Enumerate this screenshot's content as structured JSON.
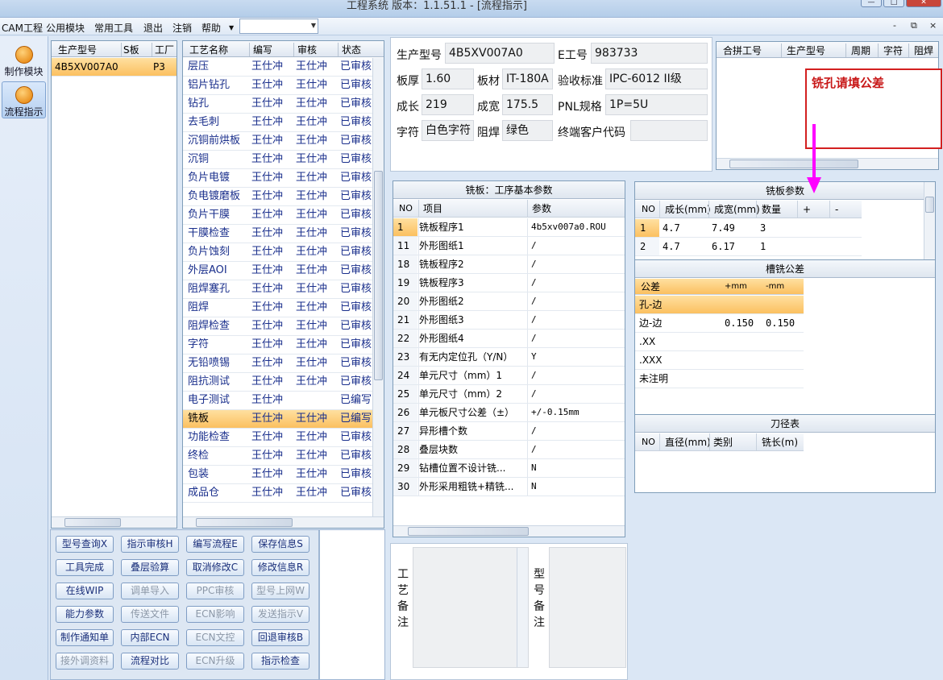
{
  "window": {
    "title": "工程系统  版本：1.1.51.1 - [流程指示]"
  },
  "menu": {
    "items": [
      "CAM工程",
      "公用模块",
      "常用工具",
      "退出",
      "注销",
      "帮助"
    ],
    "mdi": [
      "-",
      "⧉",
      "×"
    ]
  },
  "sidebar": {
    "items": [
      {
        "label": "制作模块"
      },
      {
        "label": "流程指示"
      }
    ]
  },
  "models": {
    "headers": [
      "生产型号",
      "S板",
      "工厂"
    ],
    "rows": [
      {
        "model": "4B5XV007A0",
        "s": "",
        "factory": "P3"
      }
    ]
  },
  "process": {
    "headers": [
      "工艺名称",
      "编写",
      "审核",
      "状态"
    ],
    "rows": [
      {
        "name": "层压",
        "writer": "王仕冲",
        "reviewer": "王仕冲",
        "status": "已审核"
      },
      {
        "name": "铝片钻孔",
        "writer": "王仕冲",
        "reviewer": "王仕冲",
        "status": "已审核"
      },
      {
        "name": "钻孔",
        "writer": "王仕冲",
        "reviewer": "王仕冲",
        "status": "已审核"
      },
      {
        "name": "去毛刺",
        "writer": "王仕冲",
        "reviewer": "王仕冲",
        "status": "已审核"
      },
      {
        "name": "沉铜前烘板",
        "writer": "王仕冲",
        "reviewer": "王仕冲",
        "status": "已审核"
      },
      {
        "name": "沉铜",
        "writer": "王仕冲",
        "reviewer": "王仕冲",
        "status": "已审核"
      },
      {
        "name": "负片电镀",
        "writer": "王仕冲",
        "reviewer": "王仕冲",
        "status": "已审核"
      },
      {
        "name": "负电镀磨板",
        "writer": "王仕冲",
        "reviewer": "王仕冲",
        "status": "已审核"
      },
      {
        "name": "负片干膜",
        "writer": "王仕冲",
        "reviewer": "王仕冲",
        "status": "已审核"
      },
      {
        "name": "干膜检查",
        "writer": "王仕冲",
        "reviewer": "王仕冲",
        "status": "已审核"
      },
      {
        "name": "负片蚀刻",
        "writer": "王仕冲",
        "reviewer": "王仕冲",
        "status": "已审核"
      },
      {
        "name": "外层AOI",
        "writer": "王仕冲",
        "reviewer": "王仕冲",
        "status": "已审核"
      },
      {
        "name": "阻焊塞孔",
        "writer": "王仕冲",
        "reviewer": "王仕冲",
        "status": "已审核"
      },
      {
        "name": "阻焊",
        "writer": "王仕冲",
        "reviewer": "王仕冲",
        "status": "已审核"
      },
      {
        "name": "阻焊检查",
        "writer": "王仕冲",
        "reviewer": "王仕冲",
        "status": "已审核"
      },
      {
        "name": "字符",
        "writer": "王仕冲",
        "reviewer": "王仕冲",
        "status": "已审核"
      },
      {
        "name": "无铅喷锡",
        "writer": "王仕冲",
        "reviewer": "王仕冲",
        "status": "已审核"
      },
      {
        "name": "阻抗测试",
        "writer": "王仕冲",
        "reviewer": "王仕冲",
        "status": "已审核"
      },
      {
        "name": "电子测试",
        "writer": "王仕冲",
        "reviewer": "",
        "status": "已编写"
      },
      {
        "name": "铣板",
        "writer": "王仕冲",
        "reviewer": "王仕冲",
        "status": "已编写"
      },
      {
        "name": "功能检查",
        "writer": "王仕冲",
        "reviewer": "王仕冲",
        "status": "已审核"
      },
      {
        "name": "终检",
        "writer": "王仕冲",
        "reviewer": "王仕冲",
        "status": "已审核"
      },
      {
        "name": "包装",
        "writer": "王仕冲",
        "reviewer": "王仕冲",
        "status": "已审核"
      },
      {
        "name": "成品仓",
        "writer": "王仕冲",
        "reviewer": "王仕冲",
        "status": "已审核"
      }
    ]
  },
  "buttons": [
    [
      "型号查询X",
      "指示审核H",
      "编写流程E",
      "保存信息S"
    ],
    [
      "工具完成",
      "叠层验算",
      "取消修改C",
      "修改信息R"
    ],
    [
      "在线WIP",
      "调单导入",
      "PPC审核",
      "型号上网W"
    ],
    [
      "能力参数",
      "传送文件",
      "ECN影响",
      "发送指示V"
    ],
    [
      "制作通知单",
      "内部ECN",
      "ECN文控",
      "回退审核B"
    ],
    [
      "接外调资料",
      "流程对比",
      "ECN升级",
      "指示检查"
    ]
  ],
  "info": {
    "model_label": "生产型号",
    "model_value": "4B5XV007A0",
    "eng_label": "E工号",
    "eng_value": "983733",
    "thick_label": "板厚",
    "thick_value": "1.60",
    "mat_label": "板材",
    "mat_value": "IT-180A",
    "std_label": "验收标准",
    "std_value": "IPC-6012 II级",
    "len_label": "成长",
    "len_value": "219",
    "wid_label": "成宽",
    "wid_value": "175.5",
    "pnl_label": "PNL规格",
    "pnl_value": "1P=5U",
    "char_label": "字符",
    "char_value": "白色字符",
    "mask_label": "阻焊",
    "mask_value": "绿色",
    "cust_label": "终端客户代码",
    "cust_value": ""
  },
  "merge": {
    "headers": [
      "合拼工号",
      "生产型号",
      "周期",
      "字符",
      "阻焊"
    ]
  },
  "annotation": {
    "text": "铣孔请填公差"
  },
  "mill_basic": {
    "title": "铣板：工序基本参数",
    "headers": [
      "NO",
      "项目",
      "参数"
    ],
    "rows": [
      {
        "no": "1",
        "item": "铣板程序1",
        "val": "4b5xv007a0.ROU"
      },
      {
        "no": "11",
        "item": "外形图纸1",
        "val": "/"
      },
      {
        "no": "18",
        "item": "铣板程序2",
        "val": "/"
      },
      {
        "no": "19",
        "item": "铣板程序3",
        "val": "/"
      },
      {
        "no": "20",
        "item": "外形图纸2",
        "val": "/"
      },
      {
        "no": "21",
        "item": "外形图纸3",
        "val": "/"
      },
      {
        "no": "22",
        "item": "外形图纸4",
        "val": "/"
      },
      {
        "no": "23",
        "item": "有无内定位孔（Y/N）",
        "val": "Y"
      },
      {
        "no": "24",
        "item": "单元尺寸（mm）1",
        "val": "/"
      },
      {
        "no": "25",
        "item": "单元尺寸（mm）2",
        "val": "/"
      },
      {
        "no": "26",
        "item": "单元板尺寸公差（±）",
        "val": "+/-0.15mm"
      },
      {
        "no": "27",
        "item": "异形槽个数",
        "val": "/"
      },
      {
        "no": "28",
        "item": "叠层块数",
        "val": "/"
      },
      {
        "no": "29",
        "item": "钻槽位置不设计铣...",
        "val": "N"
      },
      {
        "no": "30",
        "item": "外形采用粗铣+精铣...",
        "val": "N"
      }
    ]
  },
  "mill_params": {
    "title": "铣板参数",
    "headers": [
      "NO",
      "成长(mm)",
      "成宽(mm)",
      "数量",
      "+",
      "-"
    ],
    "rows": [
      {
        "no": "1",
        "len": "4.7",
        "wid": "7.49",
        "qty": "3"
      },
      {
        "no": "2",
        "len": "4.7",
        "wid": "6.17",
        "qty": "1"
      }
    ]
  },
  "slot_tol": {
    "title": "槽铣公差",
    "headers": [
      "公差",
      "+mm",
      "-mm"
    ],
    "rows": [
      {
        "name": "孔-边",
        "plus": "",
        "minus": ""
      },
      {
        "name": "边-边",
        "plus": "0.150",
        "minus": "0.150"
      },
      {
        "name": ".XX",
        "plus": "",
        "minus": ""
      },
      {
        "name": ".XXX",
        "plus": "",
        "minus": ""
      },
      {
        "name": "未注明",
        "plus": "",
        "minus": ""
      }
    ]
  },
  "tools": {
    "title": "刀径表",
    "headers": [
      "NO",
      "直径(mm)",
      "类别",
      "铣长(m)"
    ]
  },
  "remarks": {
    "process_label": "工艺备注",
    "model_label": "型号备注"
  }
}
